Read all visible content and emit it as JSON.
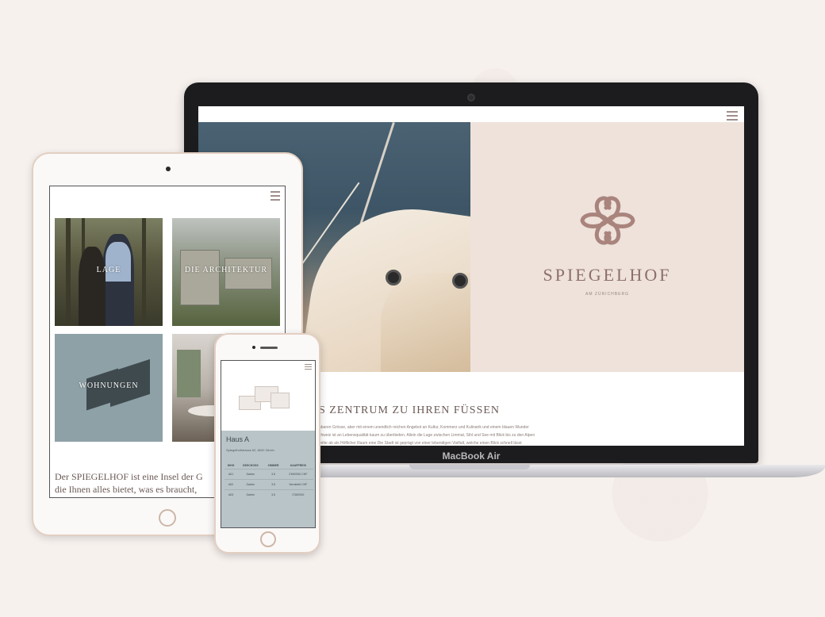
{
  "laptop": {
    "brand": "MacBook Air",
    "site": {
      "logo_name": "SPIEGELHOF",
      "logo_sub": "AM ZÜRICHBERG",
      "section_title": "S ZENTRUM ZU IHREN FÜSSEN",
      "body_lines": [
        "hbaren Grösse, aber mit einem unendlich reichen Angebot an Kultur, Kommerz und Kulinarik und einem blauen Wunder",
        "chweiz ist an Lebensqualität kaum zu überbieten. Allein die Lage zwischen Limmat, Sihl und See mit Blick bis zu den Alpen",
        "mitte ab als Höflicher Raum eine Die Stadt ist geprägt von einer lebendigen Vielfalt, welche einen Blick schnell lässt"
      ]
    }
  },
  "tablet": {
    "tiles": [
      {
        "label": "LAGE"
      },
      {
        "label": "DIE ARCHITEKTUR"
      },
      {
        "label": "WOHNUNGEN"
      },
      {
        "label": ""
      }
    ],
    "text_line1": "Der SPIEGELHOF ist eine Insel der G",
    "text_line2": "die Ihnen alles bietet, was es braucht, "
  },
  "phone": {
    "title": "Haus A",
    "subtitle": "Spiegelhofstrasse 62, 8032 Zürich",
    "table": {
      "headers": [
        "WHG",
        "GESCHOSS",
        "ZIMMER",
        "KAUFPREIS"
      ],
      "rows": [
        [
          "A01",
          "Garten",
          "3.5",
          "2'690'000 CHF"
        ],
        [
          "A02",
          "Garten",
          "3.5",
          "Vermietet CHF"
        ],
        [
          "A03",
          "Garten",
          "3.5",
          "2'350'000"
        ]
      ]
    }
  },
  "colors": {
    "background": "#f7f1ee",
    "accent": "#8d6f6a",
    "panel": "#eee2db",
    "blue_panel": "#b8c4c8"
  }
}
